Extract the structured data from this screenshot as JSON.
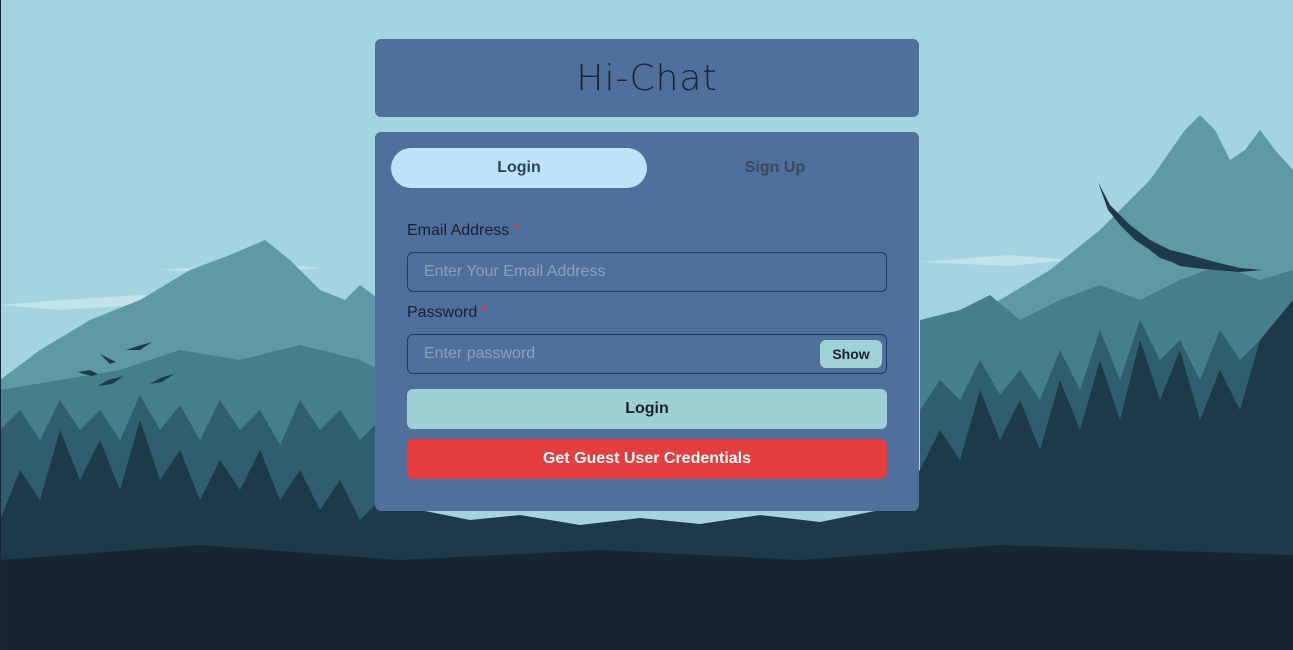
{
  "app": {
    "title": "Hi-Chat"
  },
  "tabs": [
    {
      "label": "Login",
      "active": true
    },
    {
      "label": "Sign Up",
      "active": false
    }
  ],
  "form": {
    "email": {
      "label": "Email Address",
      "required_mark": "*",
      "placeholder": "Enter Your Email Address",
      "value": ""
    },
    "password": {
      "label": "Password",
      "required_mark": "*",
      "placeholder": "Enter password",
      "value": "",
      "toggle_label": "Show"
    },
    "login_button": "Login",
    "guest_button": "Get Guest User Credentials"
  },
  "colors": {
    "sky": "#a4d4df",
    "card": "#4f6f9c",
    "tab_active": "#bee3f8",
    "login_button": "#9fcfd3",
    "guest_button": "#e53e3e"
  }
}
